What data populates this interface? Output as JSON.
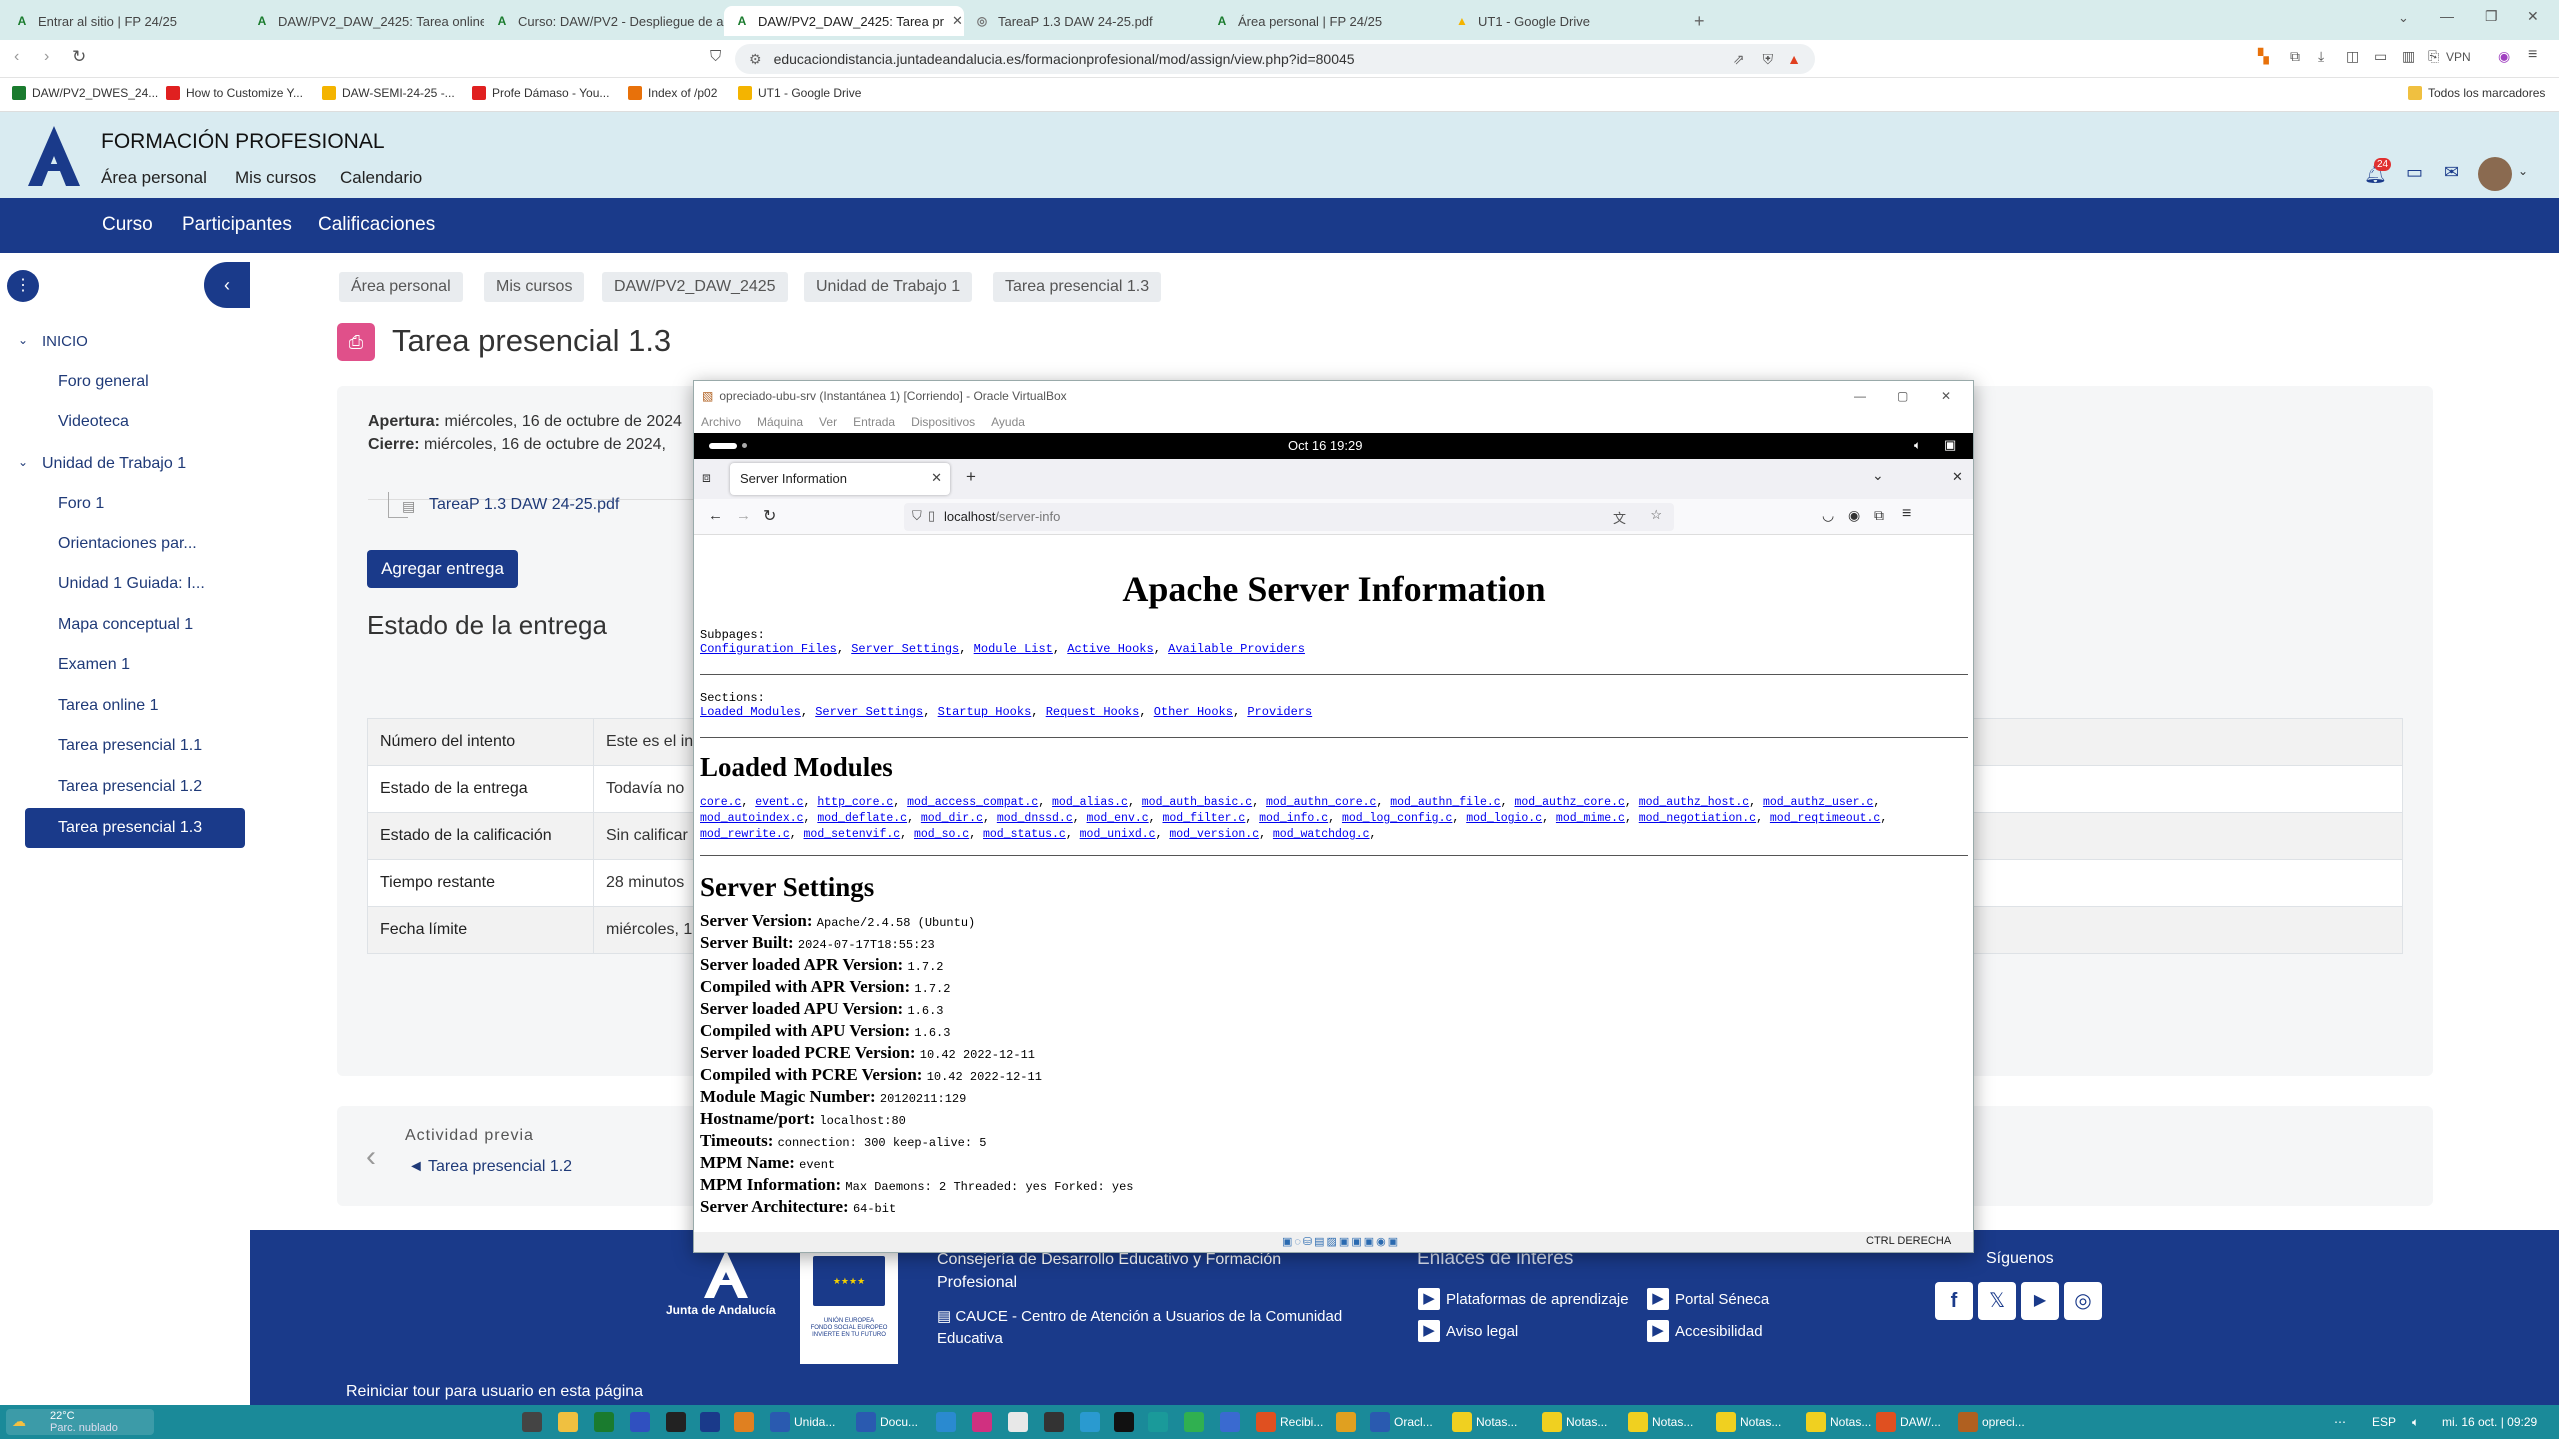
{
  "browser": {
    "tabs": [
      {
        "label": "Entrar al sitio | FP 24/25"
      },
      {
        "label": "DAW/PV2_DAW_2425: Tarea online"
      },
      {
        "label": "Curso: DAW/PV2 - Despliegue de a"
      },
      {
        "label": "DAW/PV2_DAW_2425: Tarea pr"
      },
      {
        "label": "TareaP 1.3 DAW 24-25.pdf"
      },
      {
        "label": "Área personal | FP 24/25"
      },
      {
        "label": "UT1 - Google Drive"
      }
    ],
    "url": "educaciondistancia.juntadeandalucia.es/formacionprofesional/mod/assign/view.php?id=80045",
    "vpn_label": "VPN",
    "bookmarks": [
      {
        "label": "DAW/PV2_DWES_24..."
      },
      {
        "label": "How to Customize Y..."
      },
      {
        "label": "DAW-SEMI-24-25 -..."
      },
      {
        "label": "Profe Dámaso - You..."
      },
      {
        "label": "Index of /p02"
      },
      {
        "label": "UT1 - Google Drive"
      }
    ],
    "all_bookmarks": "Todos los marcadores"
  },
  "site": {
    "brand": "FORMACIÓN PROFESIONAL",
    "top_links": [
      "Área personal",
      "Mis cursos",
      "Calendario"
    ],
    "notif_count": "24",
    "nav": [
      "Curso",
      "Participantes",
      "Calificaciones"
    ]
  },
  "sidebar": {
    "inicio": "INICIO",
    "inicio_items": [
      "Foro general",
      "Videoteca"
    ],
    "unidad": "Unidad de Trabajo 1",
    "unidad_items": [
      "Foro 1",
      "Orientaciones par...",
      "Unidad 1 Guiada: I...",
      "Mapa conceptual 1",
      "Examen 1",
      "Tarea online 1",
      "Tarea presencial 1.1",
      "Tarea presencial 1.2"
    ],
    "active_item": "Tarea presencial 1.3"
  },
  "breadcrumb": [
    "Área personal",
    "Mis cursos",
    "DAW/PV2_DAW_2425",
    "Unidad de Trabajo 1",
    "Tarea presencial 1.3"
  ],
  "page": {
    "title": "Tarea presencial 1.3",
    "apertura_label": "Apertura:",
    "apertura_value": "miércoles, 16 de octubre de 2024",
    "cierre_label": "Cierre:",
    "cierre_value": "miércoles, 16 de octubre de 2024,",
    "file": "TareaP 1.3 DAW 24-25.pdf",
    "submit_button": "Agregar entrega",
    "status_heading": "Estado de la entrega",
    "table": [
      {
        "label": "Número del intento",
        "value": "Este es el int"
      },
      {
        "label": "Estado de la entrega",
        "value": "Todavía no"
      },
      {
        "label": "Estado de la calificación",
        "value": "Sin calificar"
      },
      {
        "label": "Tiempo restante",
        "value": "28 minutos"
      },
      {
        "label": "Fecha límite",
        "value": "miércoles, 1"
      }
    ],
    "prev_label": "Actividad previa",
    "prev_link": "◄ Tarea presencial 1.2"
  },
  "vbox": {
    "title": "opreciado-ubu-srv (Instantánea 1) [Corriendo] - Oracle VirtualBox",
    "menu": [
      "Archivo",
      "Máquina",
      "Ver",
      "Entrada",
      "Dispositivos",
      "Ayuda"
    ],
    "clock": "Oct 16  19:29",
    "host_key": "CTRL DERECHA",
    "firefox_tab": "Server Information",
    "firefox_url_host": "localhost",
    "firefox_url_path": "/server-info"
  },
  "apache": {
    "title": "Apache Server Information",
    "subpages_label": "Subpages:",
    "subpages": [
      "Configuration Files",
      "Server Settings",
      "Module List",
      "Active Hooks",
      "Available Providers"
    ],
    "sections_label": "Sections:",
    "sections": [
      "Loaded Modules",
      "Server Settings",
      "Startup Hooks",
      "Request Hooks",
      "Other Hooks",
      "Providers"
    ],
    "modules_heading": "Loaded Modules",
    "modules_line1": [
      "core.c",
      "event.c",
      "http_core.c",
      "mod_access_compat.c",
      "mod_alias.c",
      "mod_auth_basic.c",
      "mod_authn_core.c",
      "mod_authn_file.c",
      "mod_authz_core.c",
      "mod_authz_host.c",
      "mod_authz_user.c"
    ],
    "modules_line2": [
      "mod_autoindex.c",
      "mod_deflate.c",
      "mod_dir.c",
      "mod_dnssd.c",
      "mod_env.c",
      "mod_filter.c",
      "mod_info.c",
      "mod_log_config.c",
      "mod_logio.c",
      "mod_mime.c",
      "mod_negotiation.c",
      "mod_reqtimeout.c"
    ],
    "modules_line3": [
      "mod_rewrite.c",
      "mod_setenvif.c",
      "mod_so.c",
      "mod_status.c",
      "mod_unixd.c",
      "mod_version.c",
      "mod_watchdog.c"
    ],
    "settings_heading": "Server Settings",
    "settings": [
      {
        "label": "Server Version:",
        "value": "Apache/2.4.58 (Ubuntu)"
      },
      {
        "label": "Server Built:",
        "value": "2024-07-17T18:55:23"
      },
      {
        "label": "Server loaded APR Version:",
        "value": "1.7.2"
      },
      {
        "label": "Compiled with APR Version:",
        "value": "1.7.2"
      },
      {
        "label": "Server loaded APU Version:",
        "value": "1.6.3"
      },
      {
        "label": "Compiled with APU Version:",
        "value": "1.6.3"
      },
      {
        "label": "Server loaded PCRE Version:",
        "value": "10.42 2022-12-11"
      },
      {
        "label": "Compiled with PCRE Version:",
        "value": "10.42 2022-12-11"
      },
      {
        "label": "Module Magic Number:",
        "value": "20120211:129"
      },
      {
        "label": "Hostname/port:",
        "value": "localhost:80"
      },
      {
        "label": "Timeouts:",
        "value": "connection: 300    keep-alive: 5"
      },
      {
        "label": "MPM Name:",
        "value": "event"
      },
      {
        "label": "MPM Information:",
        "value": "Max Daemons: 2 Threaded: yes Forked: yes"
      },
      {
        "label": "Server Architecture:",
        "value": "64-bit"
      }
    ]
  },
  "footer": {
    "junta": "Junta de Andalucía",
    "eu_text": "UNIÓN EUROPEA",
    "eu_sub": "FONDO SOCIAL EUROPEO",
    "eu_motto": "INVIERTE EN TU FUTURO",
    "consejeria": "Consejería de Desarrollo Educativo y Formación Profesional",
    "cauce": "CAUCE - Centro de Atención a Usuarios de la Comunidad Educativa",
    "enlaces_heading": "Enlaces de interés",
    "links": [
      "Plataformas de aprendizaje",
      "Portal Séneca",
      "Aviso legal",
      "Accesibilidad"
    ],
    "siguenos": "Síguenos",
    "tour": "Reiniciar tour para usuario en esta página"
  },
  "taskbar": {
    "weather_temp": "22°C",
    "weather_desc": "Parc. nublado",
    "apps": [
      "Unida...",
      "Docu...",
      "Recibi...",
      "Oracl...",
      "Notas...",
      "Notas...",
      "Notas...",
      "Notas...",
      "Notas...",
      "DAW/...",
      "opreci..."
    ],
    "lang": "ESP",
    "datetime": "mi. 16 oct. | 09:29"
  }
}
